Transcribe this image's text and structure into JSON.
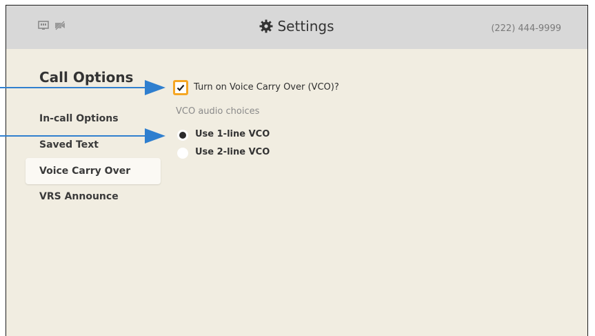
{
  "header": {
    "title": "Settings",
    "phone": "(222) 444-9999",
    "icons": [
      "ethernet-icon",
      "video-off-icon",
      "gear-icon"
    ]
  },
  "sidebar": {
    "title": "Call Options",
    "items": [
      {
        "label": "In-call Options",
        "active": false
      },
      {
        "label": "Saved Text",
        "active": false
      },
      {
        "label": "Voice Carry Over",
        "active": true
      },
      {
        "label": "VRS Announce",
        "active": false
      }
    ]
  },
  "content": {
    "vco_checkbox_label": "Turn on Voice Carry Over (VCO)?",
    "vco_checked": true,
    "audio_group_label": "VCO audio choices",
    "options": [
      {
        "label": "Use 1-line VCO",
        "selected": true
      },
      {
        "label": "Use 2-line VCO",
        "selected": false
      }
    ]
  },
  "colors": {
    "accent": "#f5a623",
    "callout": "#2f7fcf",
    "background": "#f1ede1",
    "header": "#d8d8d8"
  }
}
